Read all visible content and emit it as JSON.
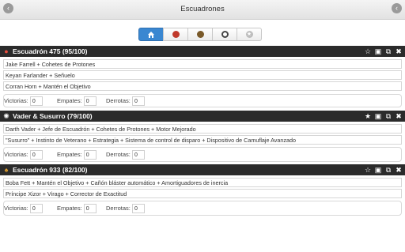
{
  "header": {
    "title": "Escuadrones"
  },
  "filters": [
    {
      "name": "home",
      "active": true
    },
    {
      "name": "rebel"
    },
    {
      "name": "scum"
    },
    {
      "name": "empire"
    },
    {
      "name": "star"
    }
  ],
  "squads": [
    {
      "title": "Escuadrón 475 (95/100)",
      "faction": "rebel",
      "pilots": [
        "Jake Farrell + Cohetes de Protones",
        "Keyan Farlander + Señuelo",
        "Corran Horn + Mantén el Objetivo"
      ],
      "stats": {
        "victorias_label": "Victorias:",
        "victorias": "0",
        "empates_label": "Empates:",
        "empates": "0",
        "derrotas_label": "Derrotas:",
        "derrotas": "0"
      }
    },
    {
      "title": "Vader & Susurro (79/100)",
      "faction": "empire",
      "pilots": [
        "Darth Vader + Jefe de Escuadrón + Cohetes de Protones + Motor Mejorado",
        "\"Susurro\" + Instinto de Veterano + Estrategia + Sistema de control de disparo + Dispositivo de Camuflaje Avanzado"
      ],
      "stats": {
        "victorias_label": "Victorias:",
        "victorias": "0",
        "empates_label": "Empates:",
        "empates": "0",
        "derrotas_label": "Derrotas:",
        "derrotas": "0"
      }
    },
    {
      "title": "Escuadrón 933 (82/100)",
      "faction": "scum",
      "pilots": [
        "Boba Fett + Mantén el Objetivo + Cañón bláster automático + Amortiguadores de inercia",
        "Príncipe Xizor + Virago + Corrector de Exactitud"
      ],
      "stats": {
        "victorias_label": "Victorias:",
        "victorias": "0",
        "empates_label": "Empates:",
        "empates": "0",
        "derrotas_label": "Derrotas:",
        "derrotas": "0"
      }
    }
  ]
}
